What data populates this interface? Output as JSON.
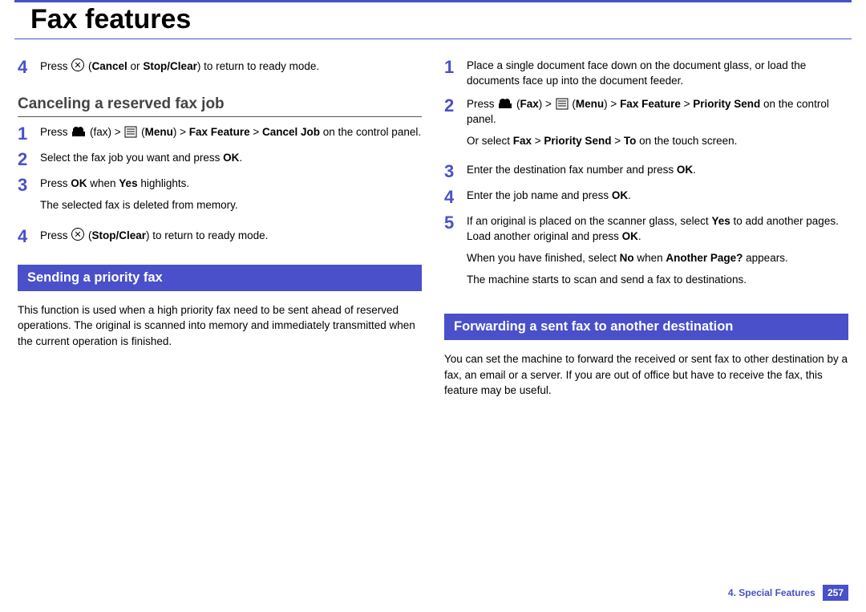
{
  "title": "Fax features",
  "left": {
    "topStep": {
      "num": "4",
      "html": "Press <span class='icon-circle' data-name='cancel-icon' data-interactable='false'></span> (<b>Cancel</b> or <b>Stop/Clear</b>) to return to ready mode."
    },
    "cancelHeading": "Canceling a reserved fax job",
    "cancelSteps": [
      {
        "num": "1",
        "html": "Press <svg class='icon-fax' data-name='fax-icon' data-interactable='false' width='18' height='15' viewBox='0 0 18 15'><path fill='#000' d='M2 4 C 3 1 6 0 9 2 C 11 0 14 1 15 4 L15 7 L2 7 Z M1 7 H17 V13 H1 Z' /></svg> (fax) > <svg class='icon-menu' data-name='menu-icon' data-interactable='false' width='16' height='15' viewBox='0 0 16 15'><rect x='1' y='1' width='14' height='13' fill='none' stroke='#000' stroke-width='1'/><line x1='3' y1='4' x2='13' y2='4' stroke='#000'/><line x1='3' y1='7' x2='13' y2='7' stroke='#000'/><line x1='3' y1='10' x2='13' y2='10' stroke='#000'/></svg> (<b>Menu</b>) > <b>Fax Feature</b> > <b>Cancel Job</b> on the control panel."
      },
      {
        "num": "2",
        "html": "Select the fax job you want and press <b>OK</b>."
      },
      {
        "num": "3",
        "html": "Press <b>OK</b> when <b>Yes</b> highlights.<p style='margin-top:8px'>The selected fax is deleted from memory.</p>"
      },
      {
        "num": "4",
        "html": "Press <span class='icon-circle' data-name='stop-clear-icon' data-interactable='false'></span> (<b>Stop/Clear</b>) to return to ready mode."
      }
    ],
    "priorityBar": "Sending a priority fax",
    "priorityIntro": "This function is used when a high priority fax need to be sent ahead of reserved operations. The original is scanned into memory and immediately transmitted when the current operation is finished."
  },
  "right": {
    "steps": [
      {
        "num": "1",
        "html": "Place a single document face down on the document glass, or load the documents face up into the document feeder."
      },
      {
        "num": "2",
        "html": "Press <svg class='icon-fax' data-name='fax-icon' data-interactable='false' width='18' height='15' viewBox='0 0 18 15'><path fill='#000' d='M2 4 C 3 1 6 0 9 2 C 11 0 14 1 15 4 L15 7 L2 7 Z M1 7 H17 V13 H1 Z' /></svg> (<b>Fax</b>) > <svg class='icon-menu' data-name='menu-icon' data-interactable='false' width='16' height='15' viewBox='0 0 16 15'><rect x='1' y='1' width='14' height='13' fill='none' stroke='#000' stroke-width='1'/><line x1='3' y1='4' x2='13' y2='4' stroke='#000'/><line x1='3' y1='7' x2='13' y2='7' stroke='#000'/><line x1='3' y1='10' x2='13' y2='10' stroke='#000'/></svg> (<b>Menu</b>) > <b>Fax Feature</b> > <b>Priority Send</b> on the control panel.<p style='margin-top:8px'>Or select <b>Fax</b> > <b>Priority Send</b> > <b>To</b> on the touch screen.</p>"
      },
      {
        "num": "3",
        "html": "Enter the destination fax number and press <b>OK</b>."
      },
      {
        "num": "4",
        "html": "Enter the job name and press <b>OK</b>."
      },
      {
        "num": "5",
        "html": "If an original is placed on the scanner glass, select <b>Yes</b> to add another pages. Load another original and press <b>OK</b>.<p style='margin-top:8px'>When you have finished, select <b>No</b> when <b>Another Page?</b> appears.</p><p>The machine starts to scan and send a fax to destinations.</p>"
      }
    ],
    "forwardBar": "Forwarding a sent  fax to another destination",
    "forwardIntro": "You can set the machine to forward the received or sent fax to other destination by a fax, an email or a server. If you are out of office but have to receive the fax, this feature may be useful."
  },
  "footer": {
    "chapter": "4.  Special Features",
    "page": "257"
  }
}
